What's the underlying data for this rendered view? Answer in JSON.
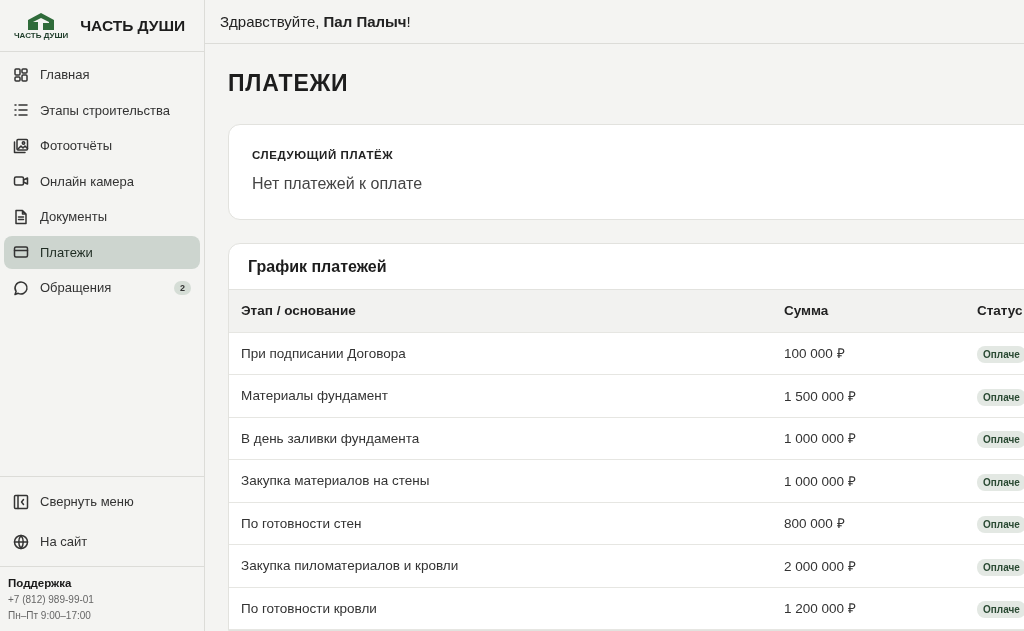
{
  "brand": {
    "logo_caption": "ЧАСТЬ ДУШИ",
    "name": "ЧАСТЬ ДУШИ"
  },
  "sidebar": {
    "items": [
      {
        "label": "Главная",
        "selected": false
      },
      {
        "label": "Этапы строительства",
        "selected": false
      },
      {
        "label": "Фотоотчёты",
        "selected": false
      },
      {
        "label": "Онлайн камера",
        "selected": false
      },
      {
        "label": "Документы",
        "selected": false
      },
      {
        "label": "Платежи",
        "selected": true
      },
      {
        "label": "Обращения",
        "selected": false,
        "badge": "2"
      }
    ],
    "footer_items": [
      {
        "label": "Свернуть меню"
      },
      {
        "label": "На сайт"
      }
    ],
    "support": {
      "title": "Поддержка",
      "phone": "+7 (812) 989-99-01",
      "hours": "Пн–Пт 9:00–17:00"
    }
  },
  "header": {
    "greeting": "Здравствуйте, **Пал Палыч**!"
  },
  "page_title": "ПЛАТЕЖИ",
  "next_payment": {
    "label": "СЛЕДУЮЩИЙ ПЛАТЁЖ",
    "text": "Нет платежей к оплате"
  },
  "schedule": {
    "title": "График платежей",
    "columns": [
      "Этап / основание",
      "Сумма",
      "Статус"
    ],
    "rows": [
      {
        "stage": "При подписании Договора",
        "amount": "100 000 ₽",
        "status": "Оплаче"
      },
      {
        "stage": "Материалы фундамент",
        "amount": "1 500 000 ₽",
        "status": "Оплаче"
      },
      {
        "stage": "В день заливки фундамента",
        "amount": "1 000 000 ₽",
        "status": "Оплаче"
      },
      {
        "stage": "Закупка материалов на стены",
        "amount": "1 000 000 ₽",
        "status": "Оплаче"
      },
      {
        "stage": "По готовности стен",
        "amount": "800 000 ₽",
        "status": "Оплаче"
      },
      {
        "stage": "Закупка пиломатериалов и кровли",
        "amount": "2 000 000 ₽",
        "status": "Оплаче"
      },
      {
        "stage": "По готовности кровли",
        "amount": "1 200 000 ₽",
        "status": "Оплаче"
      }
    ]
  }
}
